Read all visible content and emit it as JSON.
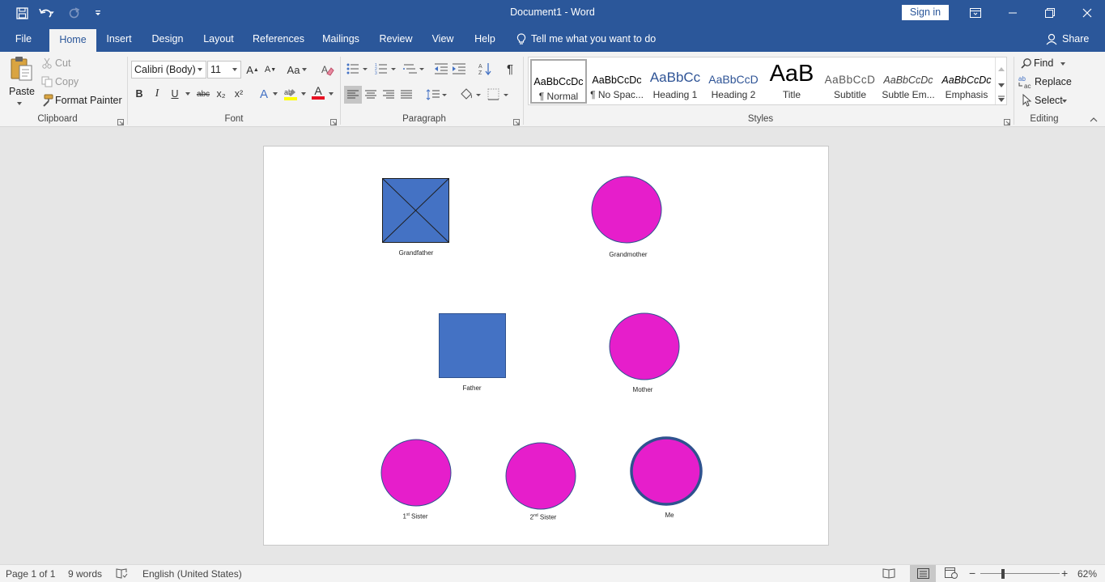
{
  "window": {
    "title": "Document1  -  Word",
    "sign_in": "Sign in"
  },
  "tabs": [
    "File",
    "Home",
    "Insert",
    "Design",
    "Layout",
    "References",
    "Mailings",
    "Review",
    "View",
    "Help"
  ],
  "active_tab": "Home",
  "tell_me": "Tell me what you want to do",
  "share": "Share",
  "clipboard": {
    "paste": "Paste",
    "cut": "Cut",
    "copy": "Copy",
    "format_painter": "Format Painter",
    "label": "Clipboard"
  },
  "font": {
    "name": "Calibri (Body)",
    "size": "11",
    "label": "Font",
    "bold": "B",
    "italic": "I",
    "underline": "U",
    "strike": "abc",
    "subscript": "x₂",
    "superscript": "x²",
    "change_case": "Aa",
    "grow": "A",
    "shrink": "A",
    "effects": "A",
    "font_color_letter": "A",
    "highlight_color": "#ffff00",
    "font_color": "#e81123"
  },
  "paragraph": {
    "label": "Paragraph"
  },
  "styles": {
    "label": "Styles",
    "items": [
      {
        "sample": "AaBbCcDc",
        "name": "¶ Normal"
      },
      {
        "sample": "AaBbCcDc",
        "name": "¶ No Spac..."
      },
      {
        "sample": "AaBbCc",
        "name": "Heading 1"
      },
      {
        "sample": "AaBbCcD",
        "name": "Heading 2"
      },
      {
        "sample": "AaB",
        "name": "Title"
      },
      {
        "sample": "AaBbCcD",
        "name": "Subtitle"
      },
      {
        "sample": "AaBbCcDc",
        "name": "Subtle Em..."
      },
      {
        "sample": "AaBbCcDc",
        "name": "Emphasis"
      }
    ]
  },
  "editing": {
    "label": "Editing",
    "find": "Find",
    "replace": "Replace",
    "select": "Select"
  },
  "document": {
    "male_color": "#4472c4",
    "female_color": "#e61ecb",
    "outline_color": "#2f528f",
    "labels": {
      "grandfather": "Grandfather",
      "grandmother": "Grandmother",
      "father": "Father",
      "mother": "Mother",
      "sister1_num": "1",
      "sister1_sup": "st",
      "sister1_rest": " Sister",
      "sister2_num": "2",
      "sister2_sup": "nd",
      "sister2_rest": " Sister",
      "me": "Me"
    }
  },
  "status": {
    "page": "Page 1 of 1",
    "words": "9 words",
    "language": "English (United States)",
    "zoom": "62%"
  }
}
